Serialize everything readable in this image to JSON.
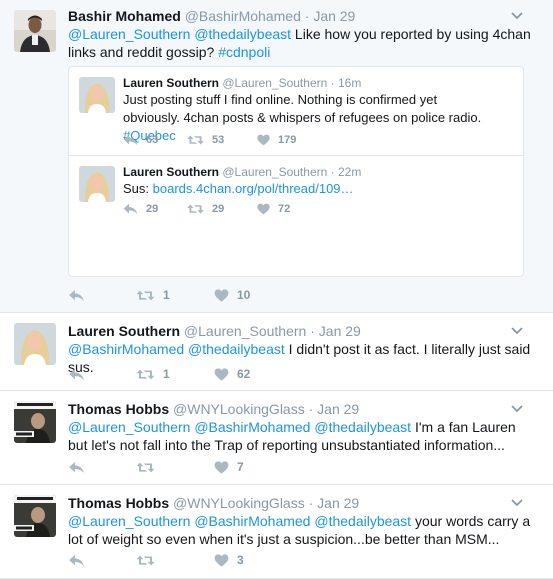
{
  "tweets": [
    {
      "name": "Bashir Mohamed",
      "handle": "@BashirMohamed",
      "sep": "·",
      "time": "Jan 29",
      "mentions": [
        "@Lauren_Southern",
        "@thedailybeast"
      ],
      "text_main": " Like how you reported by using 4chan links and reddit gossip? ",
      "hashtag": "#cdnpoli",
      "retweets": "1",
      "likes": "10",
      "replies": "",
      "quoted": [
        {
          "name": "Lauren Southern",
          "handle": "@Lauren_Southern",
          "sep": "·",
          "time": "16m",
          "text_main": "Just posting stuff I find online. Nothing is confirmed yet obviously. 4chan posts & whispers of refugees on police radio. ",
          "hashtag": "#Quebec",
          "replies": "63",
          "retweets": "53",
          "likes": "179"
        },
        {
          "name": "Lauren Southern",
          "handle": "@Lauren_Southern",
          "sep": "·",
          "time": "22m",
          "text_prefix": "Sus: ",
          "link": "boards.4chan.org/pol/thread/109…",
          "replies": "29",
          "retweets": "29",
          "likes": "72"
        }
      ]
    },
    {
      "name": "Lauren Southern",
      "handle": "@Lauren_Southern",
      "sep": "·",
      "time": "Jan 29",
      "mentions": [
        "@BashirMohamed",
        "@thedailybeast"
      ],
      "text_main": " I didn't post it as fact. I literally just said sus.",
      "retweets": "1",
      "likes": "62"
    },
    {
      "name": "Thomas Hobbs",
      "handle": "@WNYLookingGlass",
      "sep": "·",
      "time": "Jan 29",
      "mentions": [
        "@Lauren_Southern",
        "@BashirMohamed",
        "@thedailybeast"
      ],
      "text_main": " I'm a fan Lauren but let's not fall into the Trap of reporting unsubstantiated information...",
      "retweets": "",
      "likes": "7"
    },
    {
      "name": "Thomas Hobbs",
      "handle": "@WNYLookingGlass",
      "sep": "·",
      "time": "Jan 29",
      "mentions": [
        "@Lauren_Southern",
        "@BashirMohamed",
        "@thedailybeast"
      ],
      "text_main": " your words carry a lot of weight so even when it's just a suspicion...be better than MSM...",
      "retweets": "",
      "likes": "3"
    }
  ],
  "colors": {
    "link": "#1b95e0",
    "muted": "#8899a6",
    "divider": "#e1e8ed",
    "background": "#e6ecf0"
  },
  "icons": [
    "reply-icon",
    "retweet-icon",
    "like-icon",
    "caret-down-icon"
  ]
}
